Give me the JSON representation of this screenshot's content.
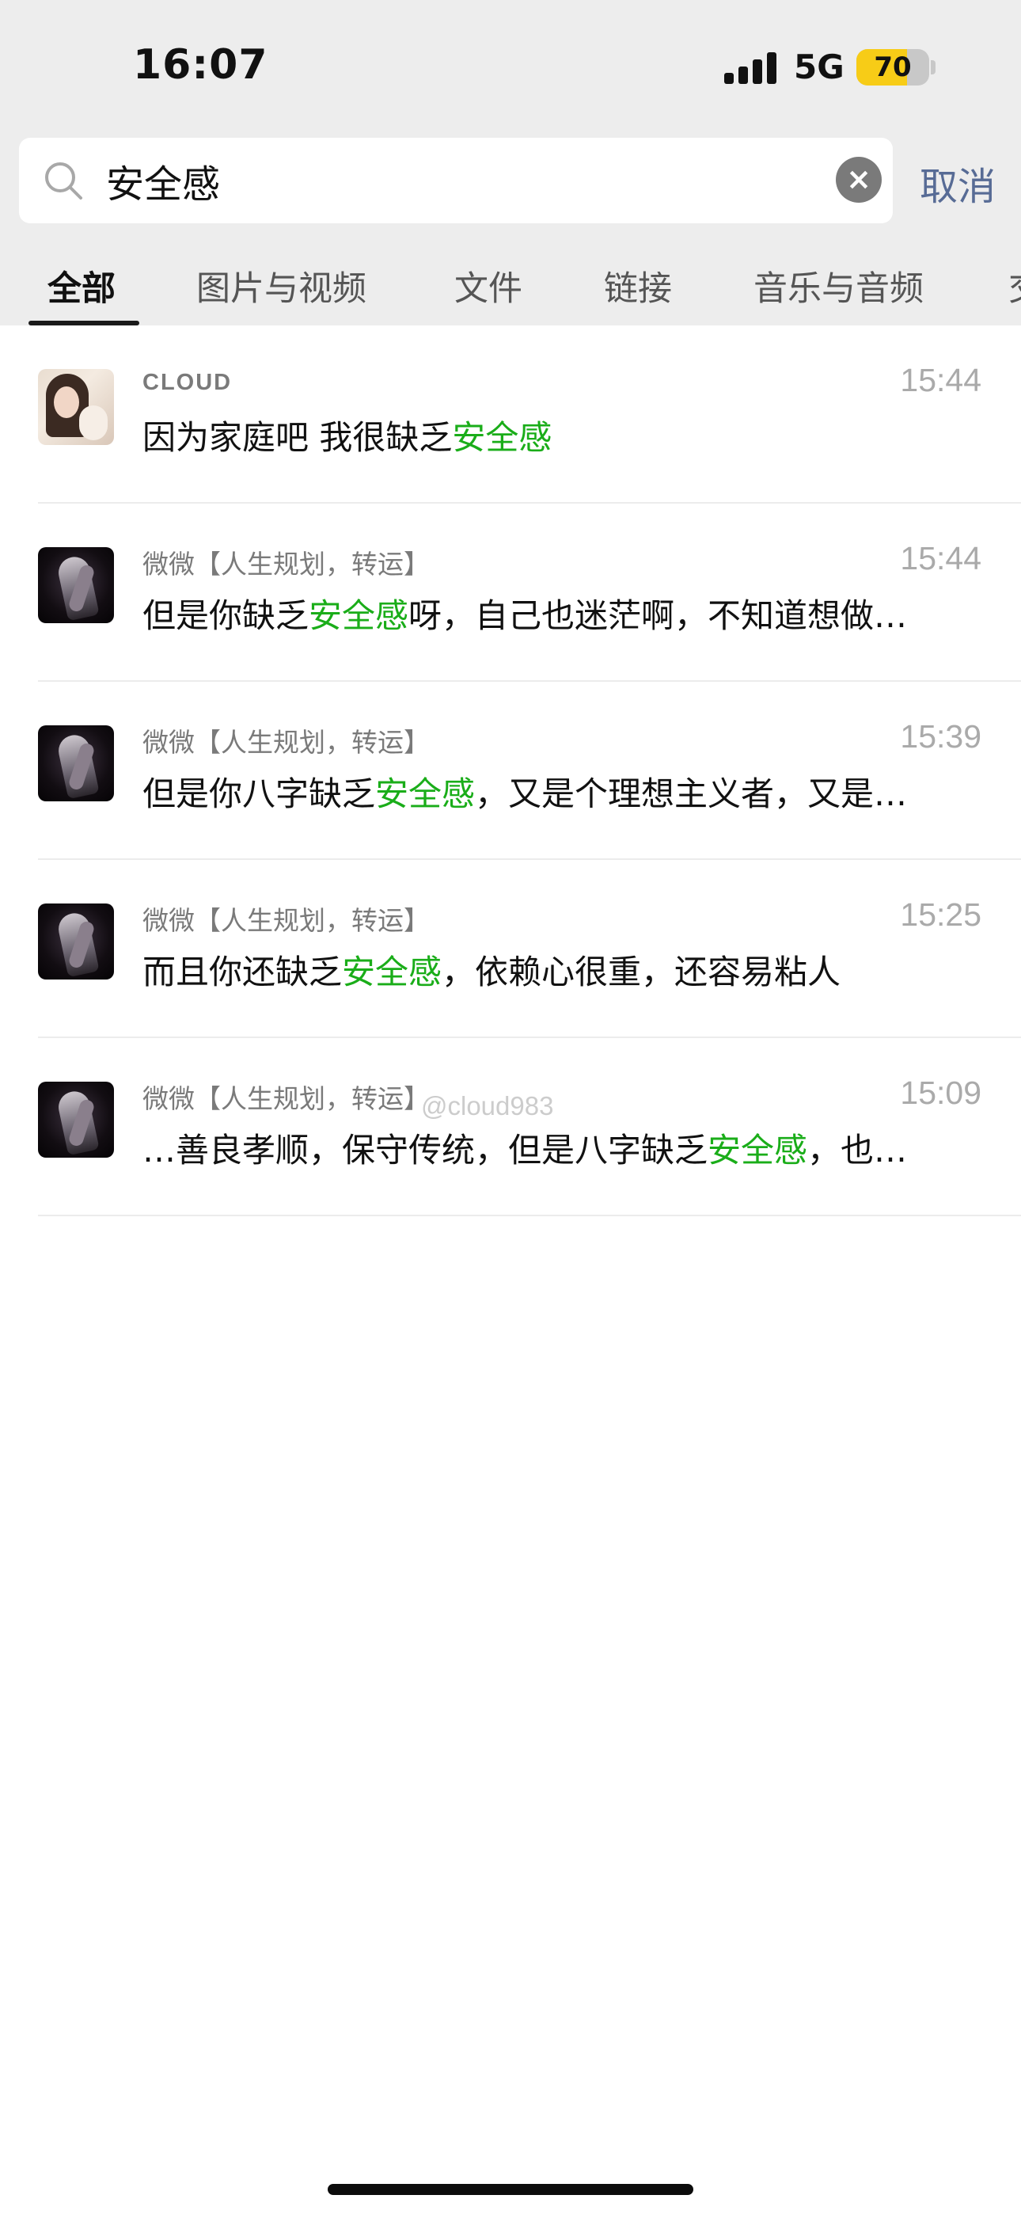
{
  "status_bar": {
    "time": "16:07",
    "network": "5G",
    "battery": "70",
    "battery_level": 0.7
  },
  "search": {
    "query": "安全感",
    "cancel_label": "取消"
  },
  "tabs": [
    "全部",
    "图片与视频",
    "文件",
    "链接",
    "音乐与音频",
    "交"
  ],
  "results": [
    {
      "sender": "CLOUD",
      "time": "15:44",
      "pre": "因为家庭吧 我很缺乏",
      "hit": "安全感",
      "post": "",
      "avatar": "cloud"
    },
    {
      "sender": "微微【人生规划，转运】",
      "time": "15:44",
      "pre": "但是你缺乏",
      "hit": "安全感",
      "post": "呀，自己也迷茫啊，不知道想做…",
      "avatar": "dark"
    },
    {
      "sender": "微微【人生规划，转运】",
      "time": "15:39",
      "pre": "但是你八字缺乏",
      "hit": "安全感",
      "post": "，又是个理想主义者，又是…",
      "avatar": "dark"
    },
    {
      "sender": "微微【人生规划，转运】",
      "time": "15:25",
      "pre": "而且你还缺乏",
      "hit": "安全感",
      "post": "，依赖心很重，还容易粘人",
      "avatar": "dark"
    },
    {
      "sender": "微微【人生规划，转运】",
      "time": "15:09",
      "pre": "…善良孝顺，保守传统，但是八字缺乏",
      "hit": "安全感",
      "post": "，也…",
      "avatar": "dark"
    }
  ],
  "watermark": "@cloud983",
  "colors": {
    "highlight": "#1aad19",
    "link": "#576b95",
    "background": "#ededed"
  }
}
